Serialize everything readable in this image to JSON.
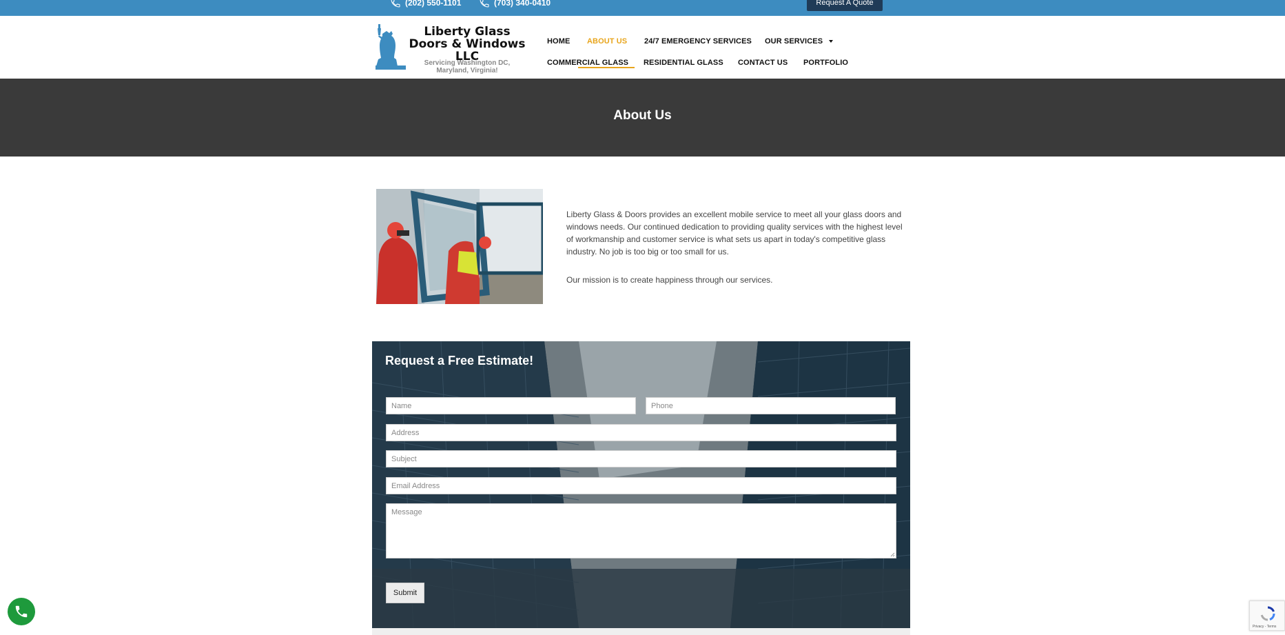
{
  "topbar": {
    "phone1": "(202) 550-1101",
    "phone2": "(703) 340-0410",
    "quote_button": "Request A Quote"
  },
  "logo": {
    "name": "Liberty Glass Doors & Windows LLC",
    "tagline": "Servicing Washington DC, Maryland, Virginia!"
  },
  "nav": {
    "home": "HOME",
    "about": "ABOUT US",
    "emergency": "24/7 EMERGENCY SERVICES",
    "services": "OUR SERVICES",
    "commercial": "COMMERCIAL GLASS",
    "residential": "RESIDENTIAL GLASS",
    "contact": "CONTACT US",
    "portfolio": "PORTFOLIO"
  },
  "banner": {
    "title": "About Us"
  },
  "about": {
    "paragraph1": "Liberty  Glass & Doors provides an excellent mobile service to meet all your glass doors and windows needs. Our continued dedication to providing quality services with the highest level of workmanship and customer service is what sets us apart in today's competitive glass industry. No job is too big or too small for us.",
    "paragraph2": "Our mission is to create happiness through our services."
  },
  "estimate": {
    "title": "Request a Free Estimate!",
    "name_placeholder": "Name",
    "phone_placeholder": "Phone",
    "address_placeholder": "Address",
    "subject_placeholder": "Subject",
    "email_placeholder": "Email Address",
    "message_placeholder": "Message",
    "submit_label": "Submit"
  },
  "recaptcha": {
    "links": "Privacy - Terms"
  },
  "colors": {
    "topbar": "#3d8cc0",
    "accent": "#e8a51c",
    "banner": "#3a3a3a",
    "call_button": "#1e9a3c"
  },
  "icons": {
    "phone": "phone-icon",
    "dropdown": "chevron-down-icon",
    "statue": "statue-of-liberty-icon"
  }
}
